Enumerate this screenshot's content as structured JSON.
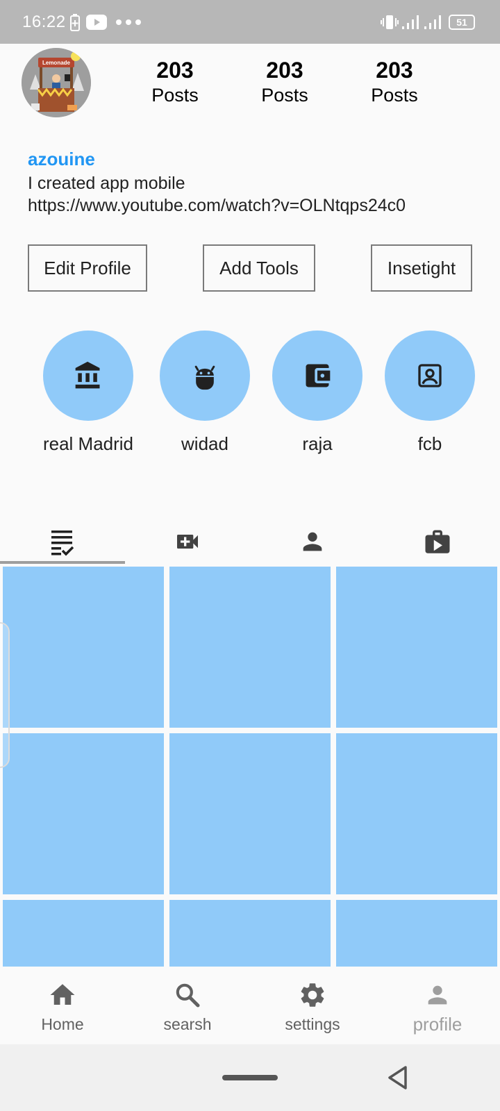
{
  "status_bar": {
    "time": "16:22",
    "battery_level": "51",
    "icons": [
      "battery-saver-icon",
      "youtube-icon",
      "more-dots-icon",
      "vibrate-icon",
      "signal-icon",
      "signal-icon",
      "battery-icon"
    ]
  },
  "profile": {
    "avatar_icon": "lemonade-stand-avatar",
    "avatar_text": "Lemonade",
    "stats": [
      {
        "value": "203",
        "label": "Posts"
      },
      {
        "value": "203",
        "label": "Posts"
      },
      {
        "value": "203",
        "label": "Posts"
      }
    ],
    "username": "azouine",
    "bio": "I created app mobile",
    "link": "https://www.youtube.com/watch?v=OLNtqps24c0"
  },
  "actions": {
    "edit_profile": "Edit Profile",
    "add_tools": "Add Tools",
    "insight": "Insetight"
  },
  "highlights": [
    {
      "label": "real Madrid",
      "icon": "account-balance-icon"
    },
    {
      "label": "widad",
      "icon": "android-icon"
    },
    {
      "label": "raja",
      "icon": "wallet-icon"
    },
    {
      "label": "fcb",
      "icon": "contact-portrait-icon"
    }
  ],
  "tabs": [
    {
      "icon": "list-check-icon",
      "active": true
    },
    {
      "icon": "video-add-icon",
      "active": false
    },
    {
      "icon": "person-icon",
      "active": false
    },
    {
      "icon": "work-play-icon",
      "active": false
    }
  ],
  "bottom_nav": [
    {
      "label": "Home",
      "icon": "home-icon"
    },
    {
      "label": "searsh",
      "icon": "search-icon"
    },
    {
      "label": "settings",
      "icon": "gear-icon"
    },
    {
      "label": "profile",
      "icon": "person-icon",
      "active": true
    }
  ],
  "colors": {
    "accent": "#2196f3",
    "tile": "#90caf9",
    "status_bar": "#b7b7b7",
    "background": "#fafafa"
  }
}
